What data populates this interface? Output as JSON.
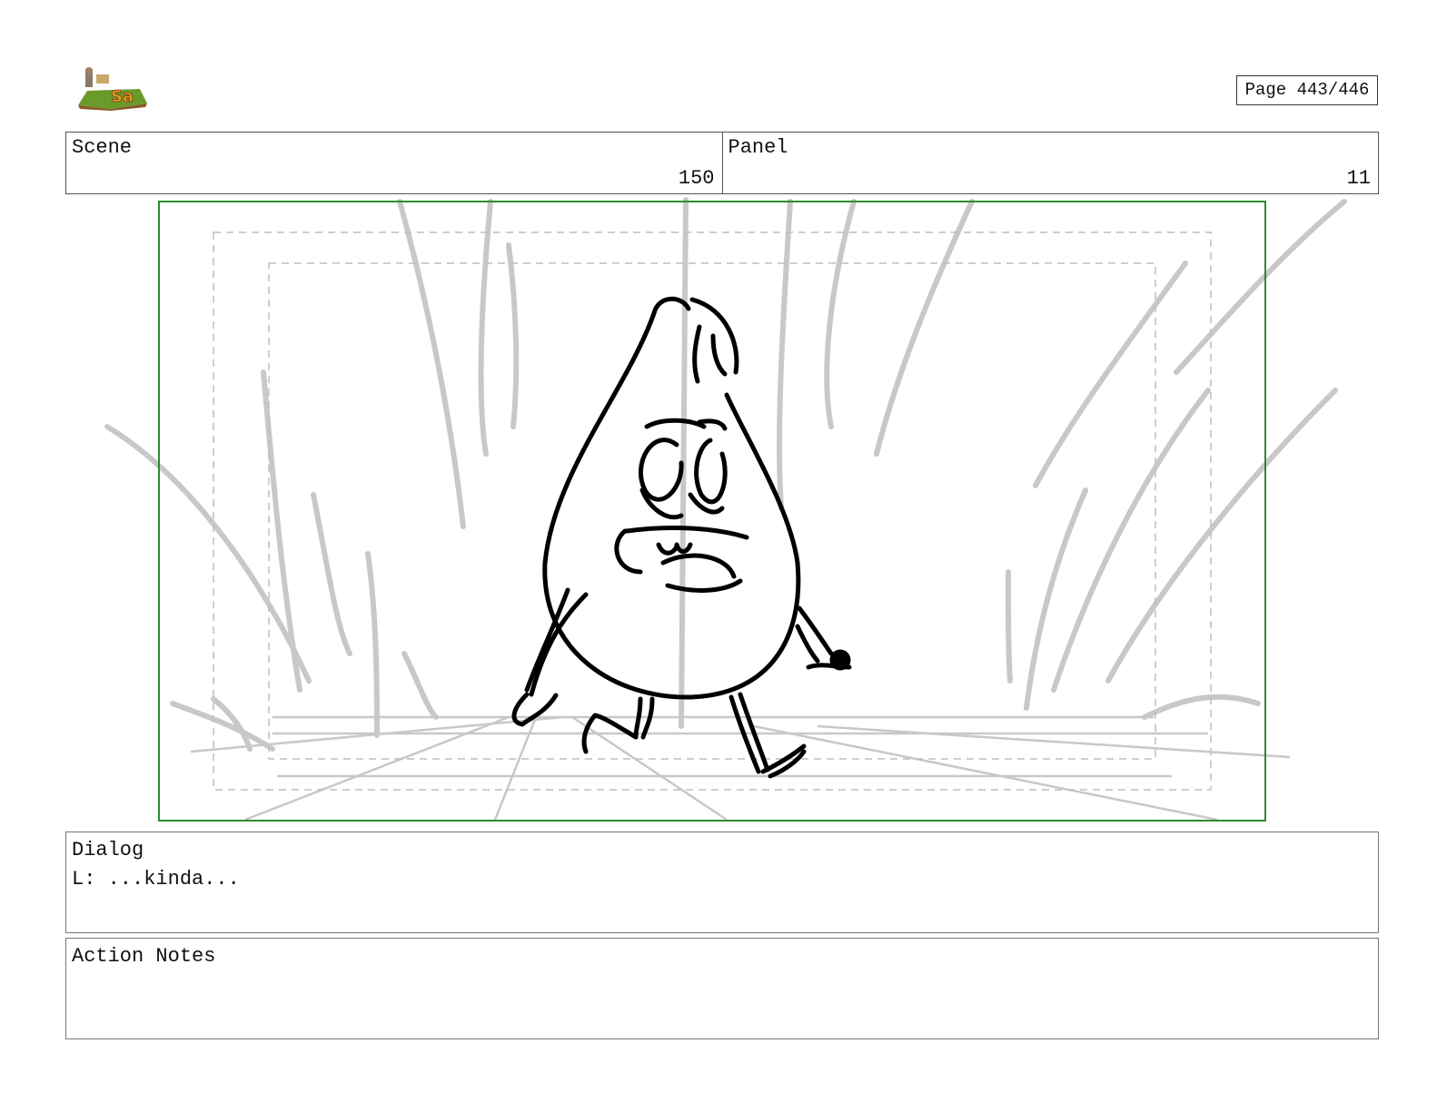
{
  "page": {
    "indicator": "Page 443/446"
  },
  "header": {
    "scene_label": "Scene",
    "scene_value": "150",
    "panel_label": "Panel",
    "panel_value": "11"
  },
  "colors": {
    "frame_border": "#2e8b2e",
    "sketch_lines": "#c8c8c8",
    "guide_lines": "#bdbdbd",
    "ink": "#000000"
  },
  "dialog": {
    "label": "Dialog",
    "text": "L: ...kinda..."
  },
  "action_notes": {
    "label": "Action Notes",
    "text": ""
  }
}
